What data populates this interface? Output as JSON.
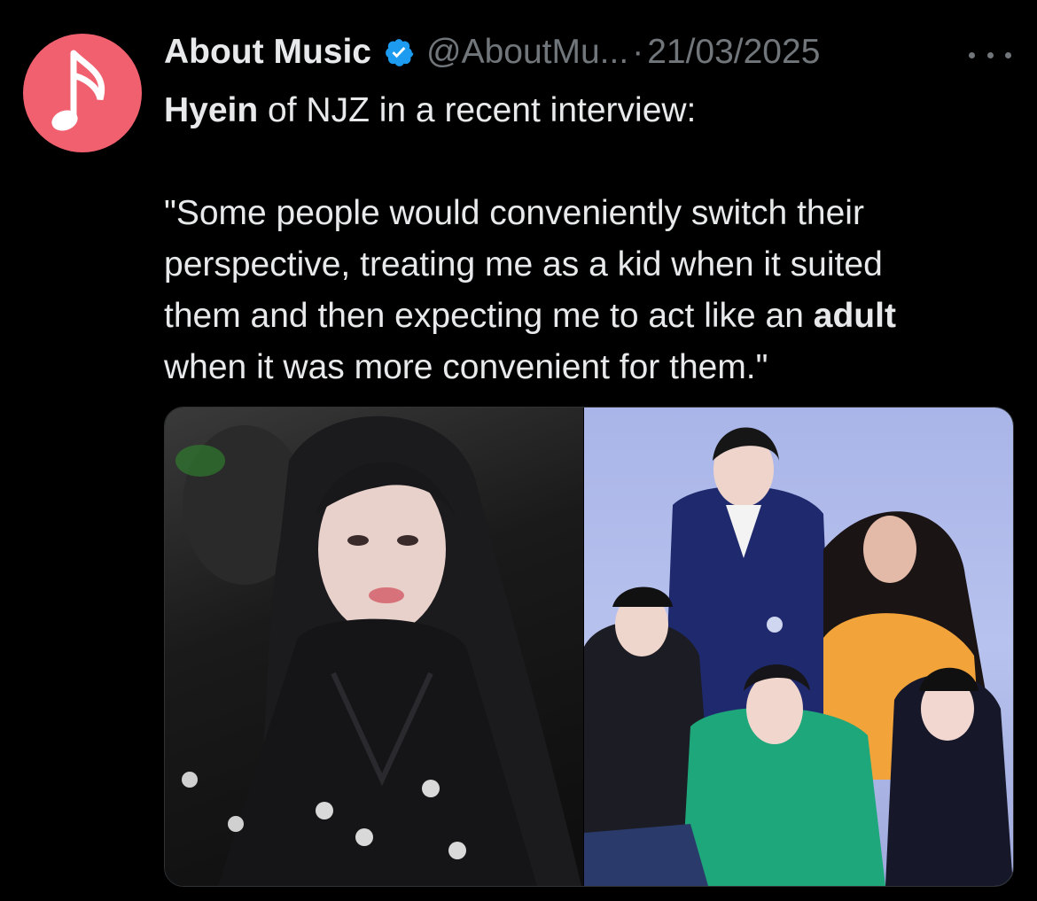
{
  "post": {
    "author": {
      "display_name": "About Music",
      "handle": "@AboutMu...",
      "verified": true,
      "avatar_icon": "music-note-icon",
      "avatar_color": "#f0606f"
    },
    "separator": "·",
    "date": "21/03/2025",
    "more_icon": "more-horizontal-icon",
    "text": {
      "lead_bold": "Hyein",
      "lead_rest": " of NJZ in a recent interview:",
      "quote_line1": "\"Some people would conveniently switch their",
      "quote_line2": "perspective, treating me as a kid when it suited",
      "quote_line3_pre": "them and then expecting me to act like an ",
      "quote_line3_bold": "adult",
      "quote_line4": "when it was more convenient for them.\""
    },
    "media": [
      {
        "kind": "photo"
      },
      {
        "kind": "photo"
      }
    ]
  },
  "colors": {
    "background": "#000000",
    "text": "#e7e9ea",
    "muted": "#71767b",
    "verified": "#1d9bf0"
  }
}
